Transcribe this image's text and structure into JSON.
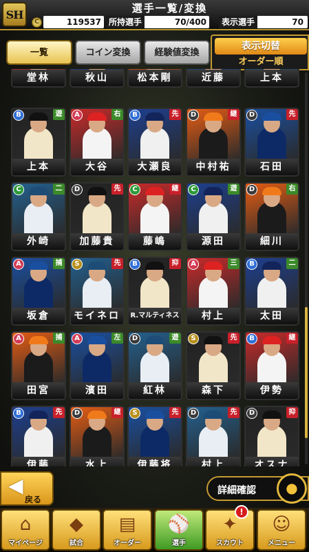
{
  "header": {
    "logo": "SH",
    "title": "選手一覧/変換",
    "coins": "119537",
    "owned_label": "所持選手",
    "owned_value": "70/400",
    "display_label": "表示選手",
    "display_value": "70"
  },
  "tabs": [
    {
      "label": "一覧"
    },
    {
      "label": "コイン変換"
    },
    {
      "label": "経験値変換"
    }
  ],
  "sort": {
    "button": "表示切替",
    "value": "オーダー順"
  },
  "rows": [
    [
      {
        "name": "堂林"
      },
      {
        "name": "秋山"
      },
      {
        "name": "松本剛"
      },
      {
        "name": "近藤"
      },
      {
        "name": "上本"
      }
    ],
    [
      {
        "name": "上本",
        "rank": "B",
        "pos": "遊"
      },
      {
        "name": "大谷",
        "rank": "A",
        "pos": "右"
      },
      {
        "name": "大瀬良",
        "rank": "B",
        "pos": "先"
      },
      {
        "name": "中村祐",
        "rank": "D",
        "pos": "継"
      },
      {
        "name": "石田",
        "rank": "D",
        "pos": "先"
      }
    ],
    [
      {
        "name": "外崎",
        "rank": "C",
        "pos": "二"
      },
      {
        "name": "加藤貴",
        "rank": "D",
        "pos": "先"
      },
      {
        "name": "藤嶋",
        "rank": "C",
        "pos": "継"
      },
      {
        "name": "源田",
        "rank": "C",
        "pos": "遊"
      },
      {
        "name": "細川",
        "rank": "D",
        "pos": "右"
      }
    ],
    [
      {
        "name": "坂倉",
        "rank": "A",
        "pos": "捕"
      },
      {
        "name": "モイネロ",
        "rank": "S",
        "pos": "先"
      },
      {
        "name": "R.マルティネス",
        "rank": "B",
        "pos": "抑"
      },
      {
        "name": "村上",
        "rank": "A",
        "pos": "三"
      },
      {
        "name": "太田",
        "rank": "B",
        "pos": "二"
      }
    ],
    [
      {
        "name": "田宮",
        "rank": "A",
        "pos": "捕"
      },
      {
        "name": "濱田",
        "rank": "A",
        "pos": "左"
      },
      {
        "name": "紅林",
        "rank": "D",
        "pos": "遊"
      },
      {
        "name": "森下",
        "rank": "S",
        "pos": "先"
      },
      {
        "name": "伊勢",
        "rank": "B",
        "pos": "継"
      }
    ],
    [
      {
        "name": "伊藤",
        "rank": "B",
        "pos": "先"
      },
      {
        "name": "水上",
        "rank": "D",
        "pos": "継"
      },
      {
        "name": "伊藤将",
        "rank": "S",
        "pos": "先"
      },
      {
        "name": "村上",
        "rank": "D",
        "pos": "先"
      },
      {
        "name": "オスナ",
        "rank": "D",
        "pos": "抑"
      }
    ]
  ],
  "controls": {
    "back": "戻る",
    "detail": "詳細確認"
  },
  "nav": [
    {
      "label": "マイページ"
    },
    {
      "label": "試合"
    },
    {
      "label": "オーダー"
    },
    {
      "label": "選手"
    },
    {
      "label": "スカウト"
    },
    {
      "label": "メニュー"
    }
  ],
  "notification_badge": "!",
  "colors": {
    "accent": "#c59b31",
    "rank_S": "#b8901c",
    "rank_A": "#d23b54",
    "rank_B": "#2f6fd6",
    "rank_C": "#2e9a3a",
    "rank_D": "#3a3a3a",
    "pos_pitcher": "#c8202a",
    "pos_fielder": "#3c8a2a"
  }
}
